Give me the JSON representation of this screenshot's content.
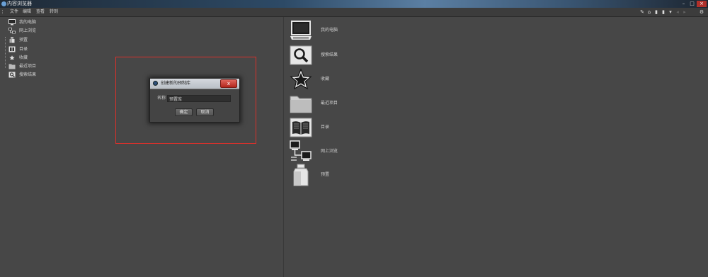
{
  "window": {
    "title": "内容浏览器"
  },
  "menubar": {
    "items": [
      "文件",
      "编辑",
      "查看",
      "转到"
    ]
  },
  "tree": {
    "items": [
      {
        "label": "我的电脑",
        "icon": "computer-icon"
      },
      {
        "label": "网上浏览",
        "icon": "network-icon"
      },
      {
        "label": "预置",
        "icon": "preset-jar-icon"
      },
      {
        "label": "目录",
        "icon": "catalog-icon"
      },
      {
        "label": "收藏",
        "icon": "star-icon"
      },
      {
        "label": "最近项目",
        "icon": "folder-icon"
      },
      {
        "label": "搜索结果",
        "icon": "search-icon"
      }
    ]
  },
  "grid": {
    "items": [
      {
        "label": "我的电脑",
        "icon": "computer-icon"
      },
      {
        "label": "搜索结果",
        "icon": "search-icon"
      },
      {
        "label": "收藏",
        "icon": "star-icon"
      },
      {
        "label": "最近项目",
        "icon": "folder-icon"
      },
      {
        "label": "目录",
        "icon": "catalog-icon"
      },
      {
        "label": "网上浏览",
        "icon": "network-icon"
      },
      {
        "label": "预置",
        "icon": "preset-jar-icon"
      }
    ]
  },
  "dialog": {
    "title": "创建新的预制库",
    "close_label": "x",
    "name_label": "名称",
    "name_value": "预置库",
    "ok_label": "确定",
    "cancel_label": "取消"
  },
  "colors": {
    "background": "#474747",
    "highlight": "#d9312b",
    "close_button": "#c2352b"
  }
}
